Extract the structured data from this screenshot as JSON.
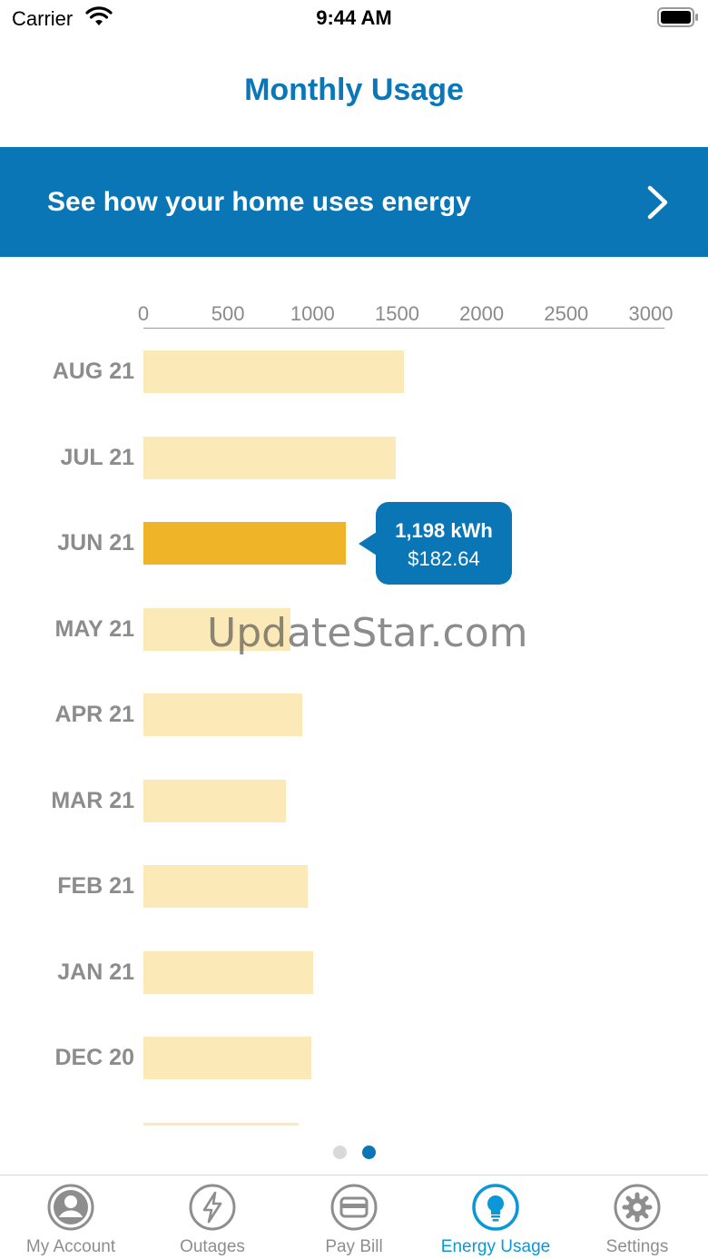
{
  "status_bar": {
    "carrier": "Carrier",
    "time": "9:44 AM"
  },
  "header": {
    "title": "Monthly Usage"
  },
  "banner": {
    "text": "See how your home uses energy",
    "icon": "chevron-right-icon"
  },
  "chart_data": {
    "type": "bar",
    "orientation": "horizontal",
    "x_ticks": [
      "0",
      "500",
      "1000",
      "1500",
      "2000",
      "2500",
      "3000"
    ],
    "xlim": [
      0,
      3000
    ],
    "categories": [
      "AUG 21",
      "JUL 21",
      "JUN 21",
      "MAY 21",
      "APR 21",
      "MAR 21",
      "FEB 21",
      "JAN 21",
      "DEC 20",
      ""
    ],
    "values": [
      1540,
      1490,
      1198,
      870,
      940,
      845,
      970,
      1005,
      995,
      920
    ],
    "selected_index": 2,
    "tooltip": {
      "kwh": "1,198 kWh",
      "cost": "$182.64"
    },
    "colors": {
      "bar": "#fbe9b7",
      "selected": "#efb427",
      "tooltip": "#0a76b6"
    }
  },
  "watermark": "UpdateStar.com",
  "pagination": {
    "count": 2,
    "active": 1,
    "active_color": "#0a76b6",
    "inactive_color": "#d9d9d9"
  },
  "tabs": [
    {
      "label": "My Account",
      "icon": "account-icon",
      "active": false
    },
    {
      "label": "Outages",
      "icon": "lightning-icon",
      "active": false
    },
    {
      "label": "Pay Bill",
      "icon": "credit-card-icon",
      "active": false
    },
    {
      "label": "Energy Usage",
      "icon": "lightbulb-icon",
      "active": true
    },
    {
      "label": "Settings",
      "icon": "gear-icon",
      "active": false
    }
  ],
  "colors": {
    "brand": "#0a76b6",
    "title": "#0a77b8",
    "tab_active": "#0a98d8",
    "tab_inactive": "#8e8e8e"
  }
}
